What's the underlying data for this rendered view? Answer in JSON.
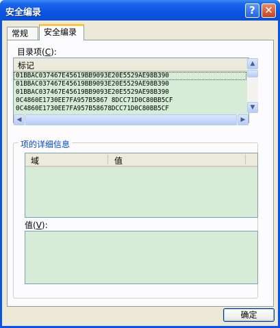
{
  "window": {
    "title": "安全编录",
    "help_glyph": "?",
    "close_glyph": "✕"
  },
  "tabs": [
    {
      "label": "常规"
    },
    {
      "label": "安全编录"
    }
  ],
  "catalog": {
    "label_text": "目录项",
    "label_mnemonic": "C",
    "label_pre": "(",
    "label_post": "):",
    "column_header": "标记",
    "rows": [
      "01BBAC037467E45619BB9093E20E5529AE98B390",
      "01BBAC037467E45619BB9093E20E5529AE98B390",
      "01BBAC037467E45619BB9093E20E5529AE98B390",
      "0C4860E1730EE7FA957B5867 8DCC71D0C80BB5CF",
      "0C4860E1730EE7FA957B58678DCC71D0C80BB5CF"
    ]
  },
  "details": {
    "group_title": "项的详细信息",
    "col_field": "域",
    "col_value": "值"
  },
  "value": {
    "label_text": "值",
    "label_mnemonic": "V",
    "label_pre": "(",
    "label_post": "):"
  },
  "ok_label": "确定"
}
